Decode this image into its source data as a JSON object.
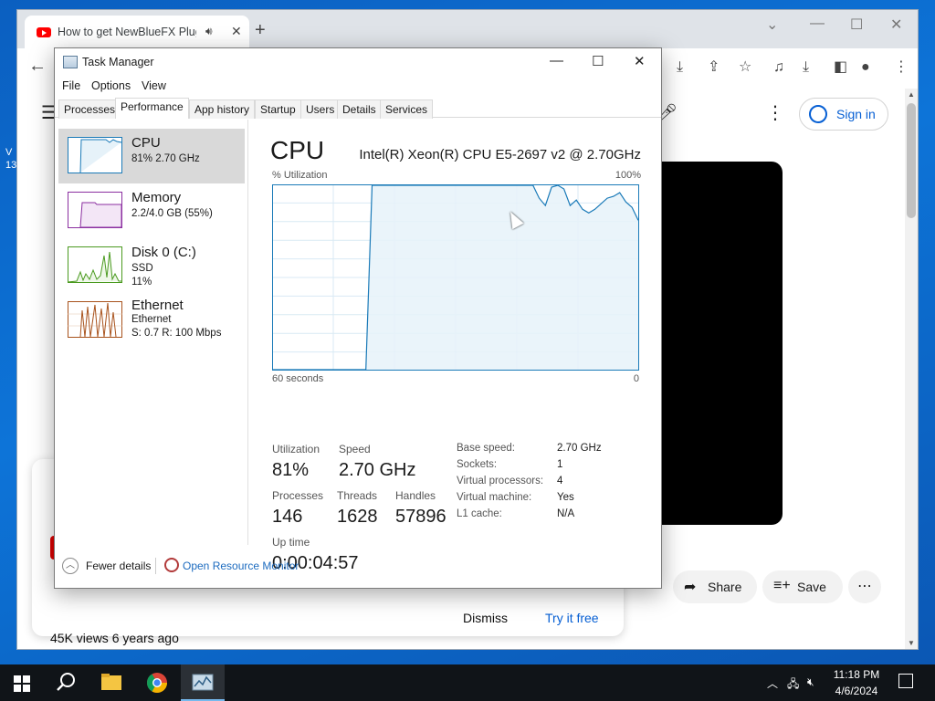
{
  "desktop": {
    "icon_label_1": "V",
    "icon_label_2": "13"
  },
  "browser": {
    "tab_title": "How to get NewBlueFX Plug",
    "tab_audio_icon": "speaker-icon",
    "tab_close": "✕",
    "new_tab": "+",
    "youtube": {
      "sign_in": "Sign in",
      "share": "Share",
      "save": "Save",
      "views": "45K views  6 years ago",
      "promo_dismiss": "Dismiss",
      "promo_try": "Try it free"
    }
  },
  "task_manager": {
    "title": "Task Manager",
    "menu": [
      "File",
      "Options",
      "View"
    ],
    "tabs": [
      "Processes",
      "Performance",
      "App history",
      "Startup",
      "Users",
      "Details",
      "Services"
    ],
    "active_tab": "Performance",
    "sidebar": [
      {
        "name": "CPU",
        "sub1": "81%  2.70 GHz",
        "sub2": "",
        "color": "#1a7ab8"
      },
      {
        "name": "Memory",
        "sub1": "2.2/4.0 GB (55%)",
        "sub2": "",
        "color": "#8b2fa0"
      },
      {
        "name": "Disk 0 (C:)",
        "sub1": "SSD",
        "sub2": "11%",
        "color": "#4a9a1f"
      },
      {
        "name": "Ethernet",
        "sub1": "Ethernet",
        "sub2": "S: 0.7  R: 100 Mbps",
        "color": "#a8521c"
      }
    ],
    "cpu": {
      "title": "CPU",
      "model": "Intel(R) Xeon(R) CPU E5-2697 v2 @ 2.70GHz",
      "utilization_label": "% Utilization",
      "utilization_max": "100%",
      "time_left": "60 seconds",
      "time_right": "0",
      "graph_color": "#1a7ab8",
      "graph_fill": "#e6f2f9",
      "history_percent": [
        0,
        0,
        0,
        0,
        0,
        0,
        0,
        0,
        0,
        0,
        0,
        0,
        0,
        0,
        0,
        0,
        100,
        100,
        100,
        100,
        100,
        100,
        100,
        100,
        100,
        100,
        100,
        100,
        100,
        100,
        100,
        100,
        100,
        100,
        100,
        100,
        100,
        100,
        100,
        100,
        100,
        100,
        100,
        93,
        89,
        99,
        100,
        98,
        89,
        92,
        87,
        85,
        87,
        90,
        93,
        94,
        96,
        91,
        88,
        81
      ],
      "stats": {
        "utilization_label": "Utilization",
        "utilization": "81%",
        "speed_label": "Speed",
        "speed": "2.70 GHz",
        "processes_label": "Processes",
        "processes": "146",
        "threads_label": "Threads",
        "threads": "1628",
        "handles_label": "Handles",
        "handles": "57896",
        "uptime_label": "Up time",
        "uptime": "0:00:04:57"
      },
      "specs": [
        {
          "label": "Base speed:",
          "value": "2.70 GHz"
        },
        {
          "label": "Sockets:",
          "value": "1"
        },
        {
          "label": "Virtual processors:",
          "value": "4"
        },
        {
          "label": "Virtual machine:",
          "value": "Yes"
        },
        {
          "label": "L1 cache:",
          "value": "N/A"
        }
      ]
    },
    "footer": {
      "fewer_details": "Fewer details",
      "open_resource_monitor": "Open Resource Monitor"
    }
  },
  "taskbar": {
    "time": "11:18 PM",
    "date": "4/6/2024"
  }
}
